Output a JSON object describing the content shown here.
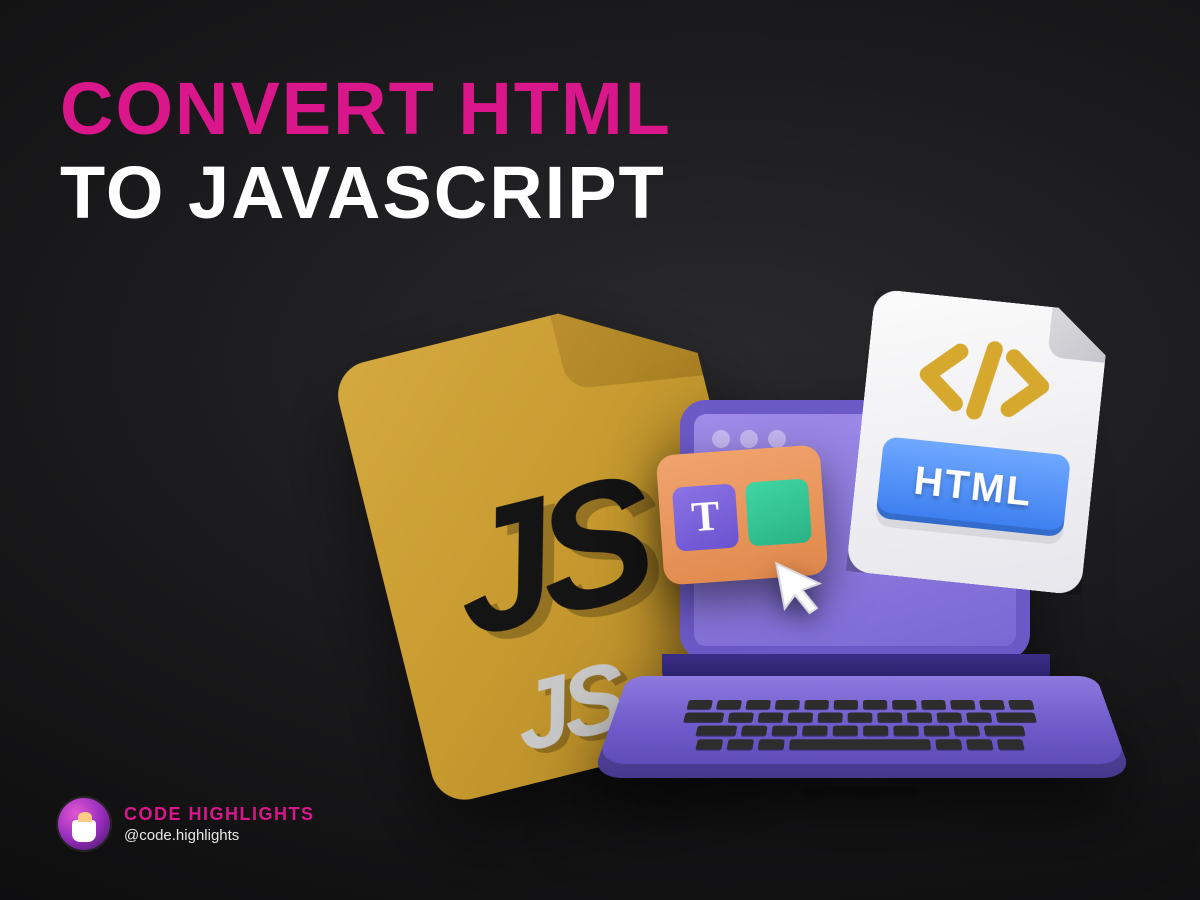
{
  "heading": {
    "line1": "CONVERT HTML",
    "line2": "TO JAVASCRIPT"
  },
  "illustration": {
    "js_big": "JS",
    "js_small": "JS",
    "html_label": "HTML",
    "t_letter": "T"
  },
  "footer": {
    "brand": "CODE HIGHLIGHTS",
    "handle": "@code.highlights"
  },
  "colors": {
    "accent_pink": "#d9168a",
    "gold": "#c69a2f",
    "purple": "#7a68d4",
    "html_blue": "#3a7def"
  }
}
